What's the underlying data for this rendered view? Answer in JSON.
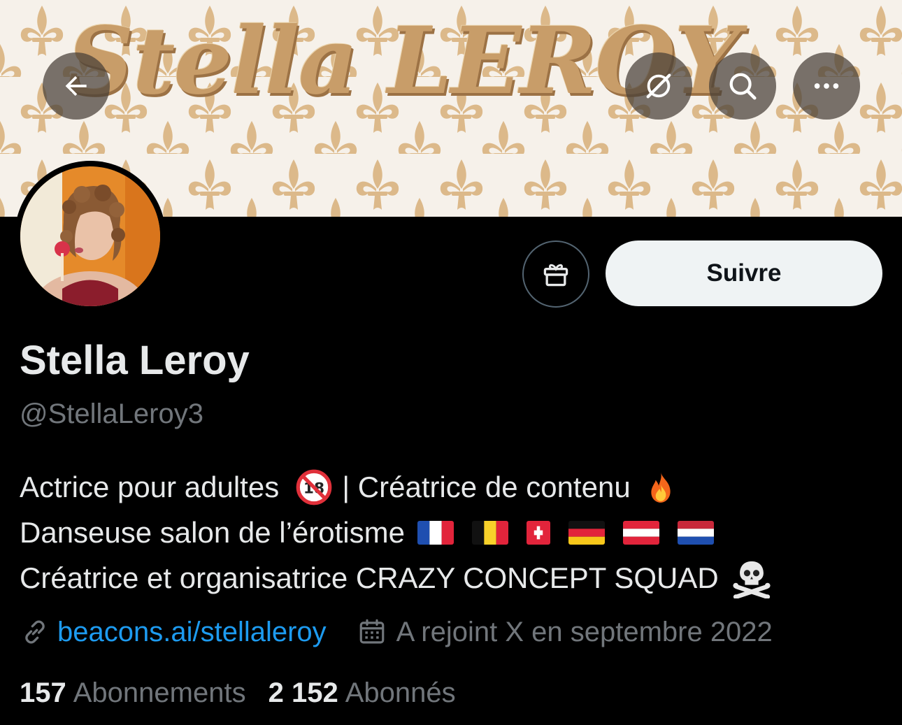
{
  "header": {
    "banner_text": "Stella LEROY",
    "back_icon": "arrow-left-icon",
    "grok_icon": "grok-icon",
    "search_icon": "search-icon",
    "more_icon": "more-horizontal-icon"
  },
  "actions": {
    "gift_icon": "gift-icon",
    "follow_label": "Suivre"
  },
  "profile": {
    "display_name": "Stella Leroy",
    "handle": "@StellaLeroy3",
    "bio": {
      "line1_a": "Actrice pour adultes",
      "line1_b": "| Créatrice de contenu",
      "line2": "Danseuse salon de l’érotisme",
      "line3": "Créatrice et organisatrice CRAZY CONCEPT SQUAD",
      "emojis": [
        "no-one-under-18-emoji",
        "fire-emoji",
        "skull-and-crossbones-emoji"
      ],
      "flags": [
        "flag-france",
        "flag-belgium",
        "flag-switzerland",
        "flag-germany",
        "flag-austria",
        "flag-netherlands"
      ]
    },
    "link_icon": "link-icon",
    "website": "beacons.ai/stellaleroy",
    "calendar_icon": "calendar-icon",
    "joined": "A rejoint X en septembre 2022"
  },
  "stats": {
    "following_count": "157",
    "following_label": "Abonnements",
    "followers_count": "2 152",
    "followers_label": "Abonnés"
  },
  "colors": {
    "background": "#000000",
    "text_primary": "#e7e9ea",
    "text_secondary": "#71767b",
    "link": "#1d9bf0",
    "follow_button_bg": "#eff3f4",
    "banner_gold": "#c89d69"
  }
}
